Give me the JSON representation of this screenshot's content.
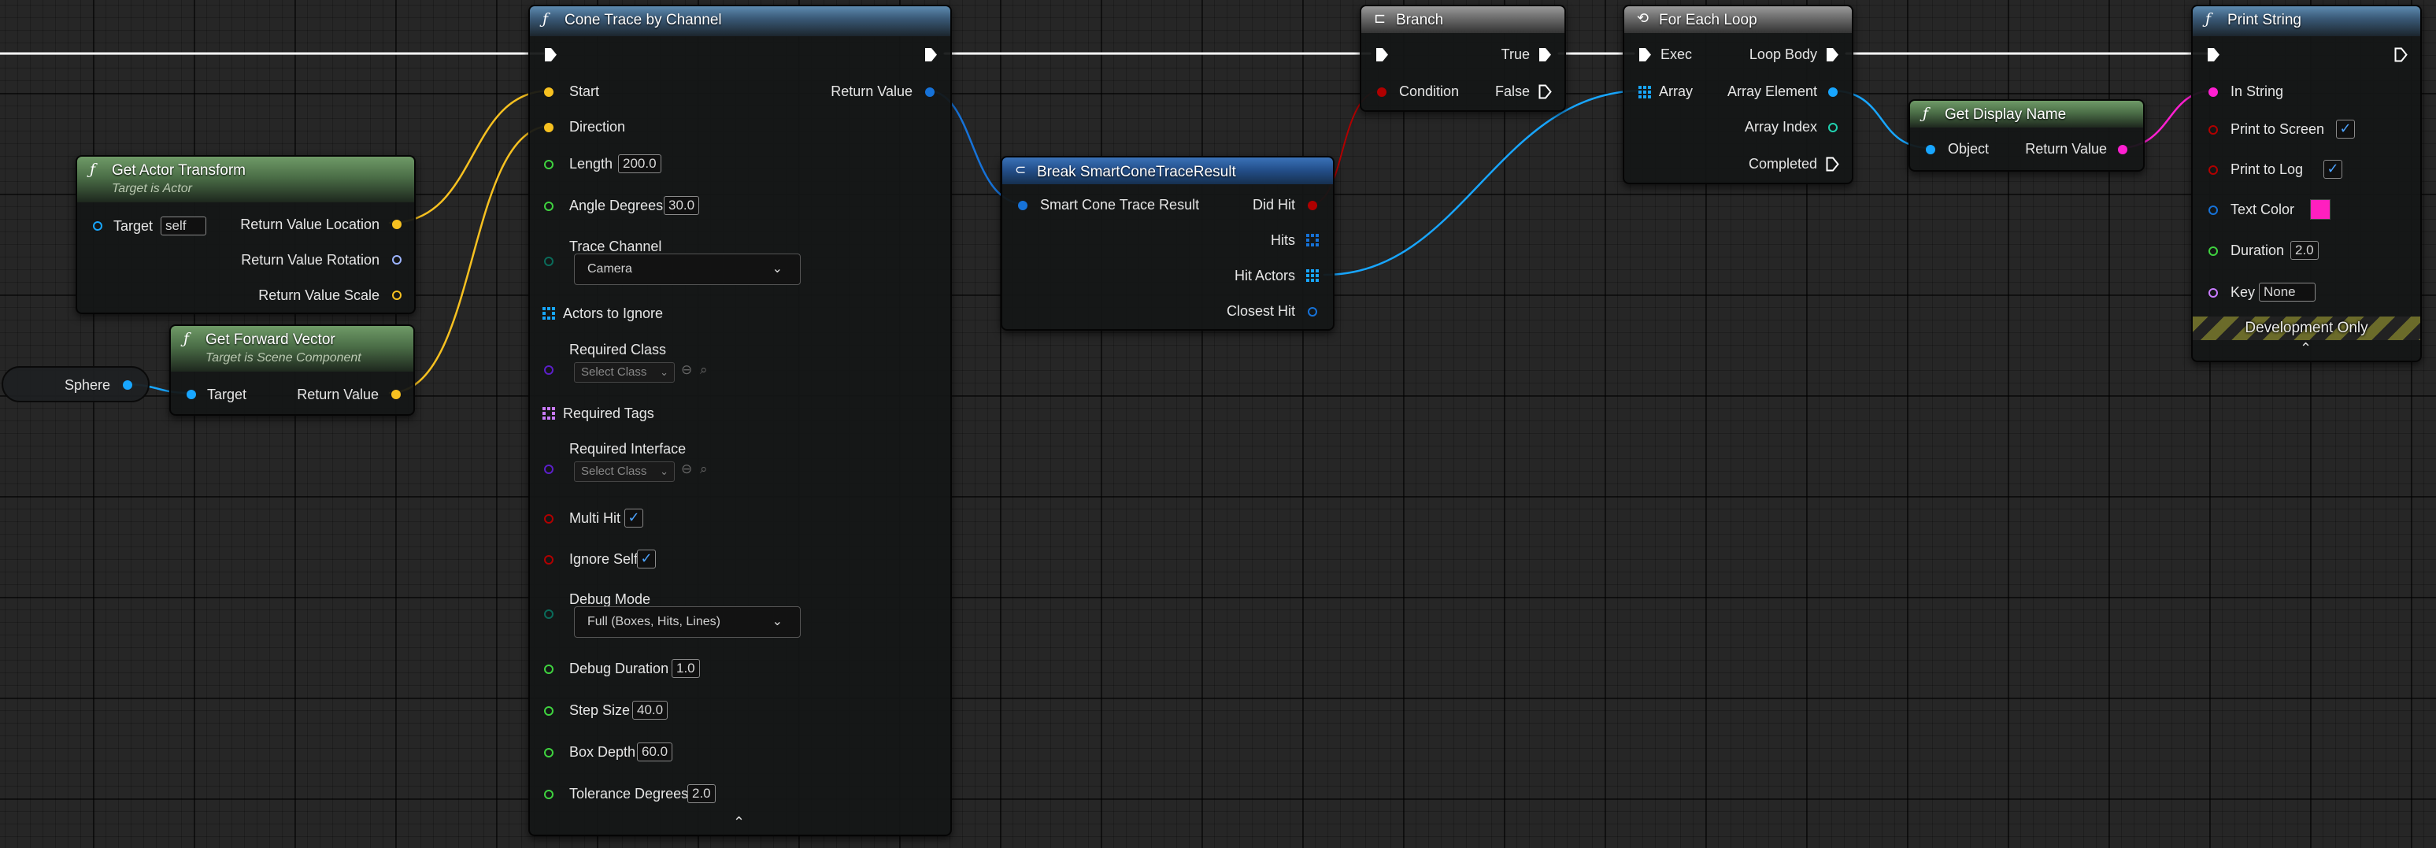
{
  "colors": {
    "exec": "#ffffff",
    "vector": "#f7c120",
    "transform": "#f0a83c",
    "rotator": "#9db4ff",
    "float": "#3fd23f",
    "object": "#18a6ff",
    "bool": "#b00000",
    "string": "#ff1fd1",
    "enum": "#0a6b5a",
    "name": "#c97bff",
    "class": "#5b1fc9",
    "struct": "#1672d8",
    "text_color_swatch": "#ff1fbf"
  },
  "get_actor_transform": {
    "title": "Get Actor Transform",
    "subtitle": "Target is Actor",
    "icon": "function-icon",
    "target_label": "Target",
    "target_value": "self",
    "out_location": "Return Value Location",
    "out_rotation": "Return Value Rotation",
    "out_scale": "Return Value Scale"
  },
  "get_forward_vector": {
    "title": "Get Forward Vector",
    "subtitle": "Target is Scene Component",
    "icon": "function-icon",
    "target_label": "Target",
    "out_return": "Return Value"
  },
  "sphere_var": {
    "label": "Sphere"
  },
  "cone_trace": {
    "title": "Cone Trace by Channel",
    "icon": "function-icon",
    "start": "Start",
    "direction": "Direction",
    "return_value": "Return Value",
    "length_label": "Length",
    "length_value": "200.0",
    "angle_label": "Angle Degrees",
    "angle_value": "30.0",
    "trace_channel_label": "Trace Channel",
    "trace_channel_value": "Camera",
    "actors_to_ignore": "Actors to Ignore",
    "required_class_label": "Required Class",
    "required_class_value": "Select Class",
    "required_tags": "Required Tags",
    "required_interface_label": "Required Interface",
    "required_interface_value": "Select Class",
    "multi_hit": "Multi Hit",
    "ignore_self": "Ignore Self",
    "debug_mode_label": "Debug Mode",
    "debug_mode_value": "Full (Boxes, Hits, Lines)",
    "debug_duration_label": "Debug Duration",
    "debug_duration_value": "1.0",
    "step_size_label": "Step Size",
    "step_size_value": "40.0",
    "box_depth_label": "Box Depth",
    "box_depth_value": "60.0",
    "tolerance_label": "Tolerance Degrees",
    "tolerance_value": "2.0"
  },
  "break_result": {
    "title": "Break SmartConeTraceResult",
    "icon": "break-struct-icon",
    "in_struct": "Smart Cone Trace Result",
    "did_hit": "Did Hit",
    "hits": "Hits",
    "hit_actors": "Hit Actors",
    "closest_hit": "Closest Hit"
  },
  "branch": {
    "title": "Branch",
    "icon": "branch-icon",
    "condition": "Condition",
    "true_label": "True",
    "false_label": "False"
  },
  "for_each": {
    "title": "For Each Loop",
    "icon": "loop-icon",
    "exec": "Exec",
    "array": "Array",
    "loop_body": "Loop Body",
    "array_element": "Array Element",
    "array_index": "Array Index",
    "completed": "Completed"
  },
  "get_display_name": {
    "title": "Get Display Name",
    "icon": "function-icon",
    "object": "Object",
    "return_value": "Return Value"
  },
  "print_string": {
    "title": "Print String",
    "icon": "function-icon",
    "in_string": "In String",
    "print_to_screen": "Print to Screen",
    "print_to_log": "Print to Log",
    "text_color": "Text Color",
    "duration_label": "Duration",
    "duration_value": "2.0",
    "key_label": "Key",
    "key_value": "None",
    "dev_only": "Development Only"
  }
}
